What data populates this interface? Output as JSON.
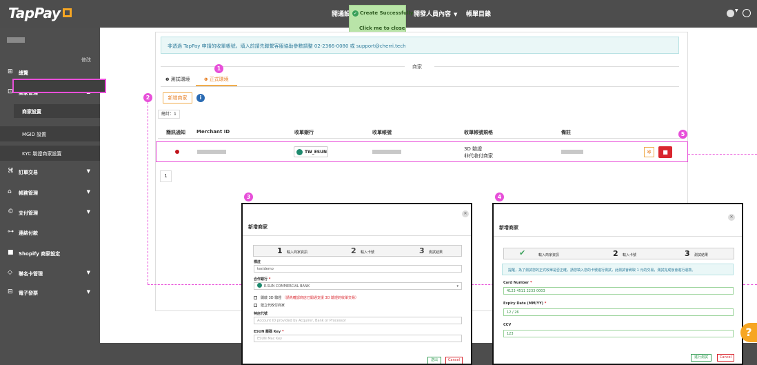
{
  "topbar": {
    "logo": "TapPay",
    "nav_item_1": "開通設",
    "nav_item_2": "開發人員內容",
    "nav_item_3": "帳單目錄",
    "toast_message": "Create Successfully",
    "toast_action": "Click me to close"
  },
  "sidebar": {
    "edit": "修改",
    "items": [
      {
        "icon": "overview-icon",
        "label": "總覽"
      },
      {
        "icon": "store-icon",
        "label": "商家管理"
      },
      {
        "label": "商家設置"
      },
      {
        "label": "MGID 設置"
      },
      {
        "label": "KYC 驗證商家設置"
      },
      {
        "icon": "order-icon",
        "label": "訂單交易"
      },
      {
        "icon": "bank-icon",
        "label": "帳務管理"
      },
      {
        "icon": "payment-icon",
        "label": "支付管理"
      },
      {
        "icon": "link-icon",
        "label": "連結付款"
      },
      {
        "icon": "shopify-icon",
        "label": "Shopify 商家設定"
      },
      {
        "icon": "cobrand-icon",
        "label": "聯名卡管理"
      },
      {
        "icon": "invoice-icon",
        "label": "電子發票"
      }
    ]
  },
  "main": {
    "notice": "非透過 TapPay 申請的收單帳號，填入前請先聯繫客服協助參數調整 02-2366-0080 或 support@cherri.tech",
    "section_title": "商家",
    "tabs": [
      "測試環境",
      "正式環境"
    ],
    "add_button": "新增商家",
    "total": "總計：1",
    "table": {
      "headers": [
        "簡訊通知",
        "Merchant ID",
        "收單銀行",
        "收單帳號",
        "收單帳號規格",
        "備註"
      ],
      "row": {
        "bank": "TW_ESUN",
        "spec_line1": "3D 驗證",
        "spec_line2": "非代收付商家"
      }
    },
    "page": "1"
  },
  "annotations": [
    "1",
    "2",
    "3",
    "4",
    "5"
  ],
  "modal_left": {
    "title": "新增商家",
    "steps": [
      {
        "num": "1",
        "label": "輸入商家資訊"
      },
      {
        "num": "2",
        "label": "輸入卡號"
      },
      {
        "num": "3",
        "label": "測試結果"
      }
    ],
    "name_label": "標註",
    "name_value": "testdemo",
    "bank_label": "合作銀行",
    "bank_value": "E.SUN COMMERCIAL BANK",
    "check1_label": "開啟 3D 驗證",
    "check1_warning": "（請先確認商店已開通支援 3D 驗證的收單交易）",
    "check2_label": "建立代收付商家",
    "merchant_code_label": "特店代號",
    "merchant_code_placeholder": "Account ID provided by Acquirer, Bank or Processor",
    "esun_key_label": "ESUN 壓碼 Key",
    "esun_key_placeholder": "ESUN Mac Key",
    "next_button": "送出",
    "cancel_button": "Cancel"
  },
  "modal_right": {
    "title": "新增商家",
    "steps": [
      {
        "num": "",
        "label": "輸入商家資訊"
      },
      {
        "num": "2",
        "label": "輸入卡號"
      },
      {
        "num": "3",
        "label": "測試結果"
      }
    ],
    "info": "提醒，為了測試您的正式收單是否正確，請您填入您的卡號進行測試，此測試會刷取 1 元的交易，測試完成後會進行退款。",
    "card_label": "Card Number",
    "card_value": "4123 4511 2233 0003",
    "expiry_label": "Expiry Date (MM/YY)",
    "expiry_value": "12 / 26",
    "ccv_label": "CCV",
    "ccv_value": "123",
    "test_button": "進行測試",
    "cancel_button": "Cancel"
  }
}
